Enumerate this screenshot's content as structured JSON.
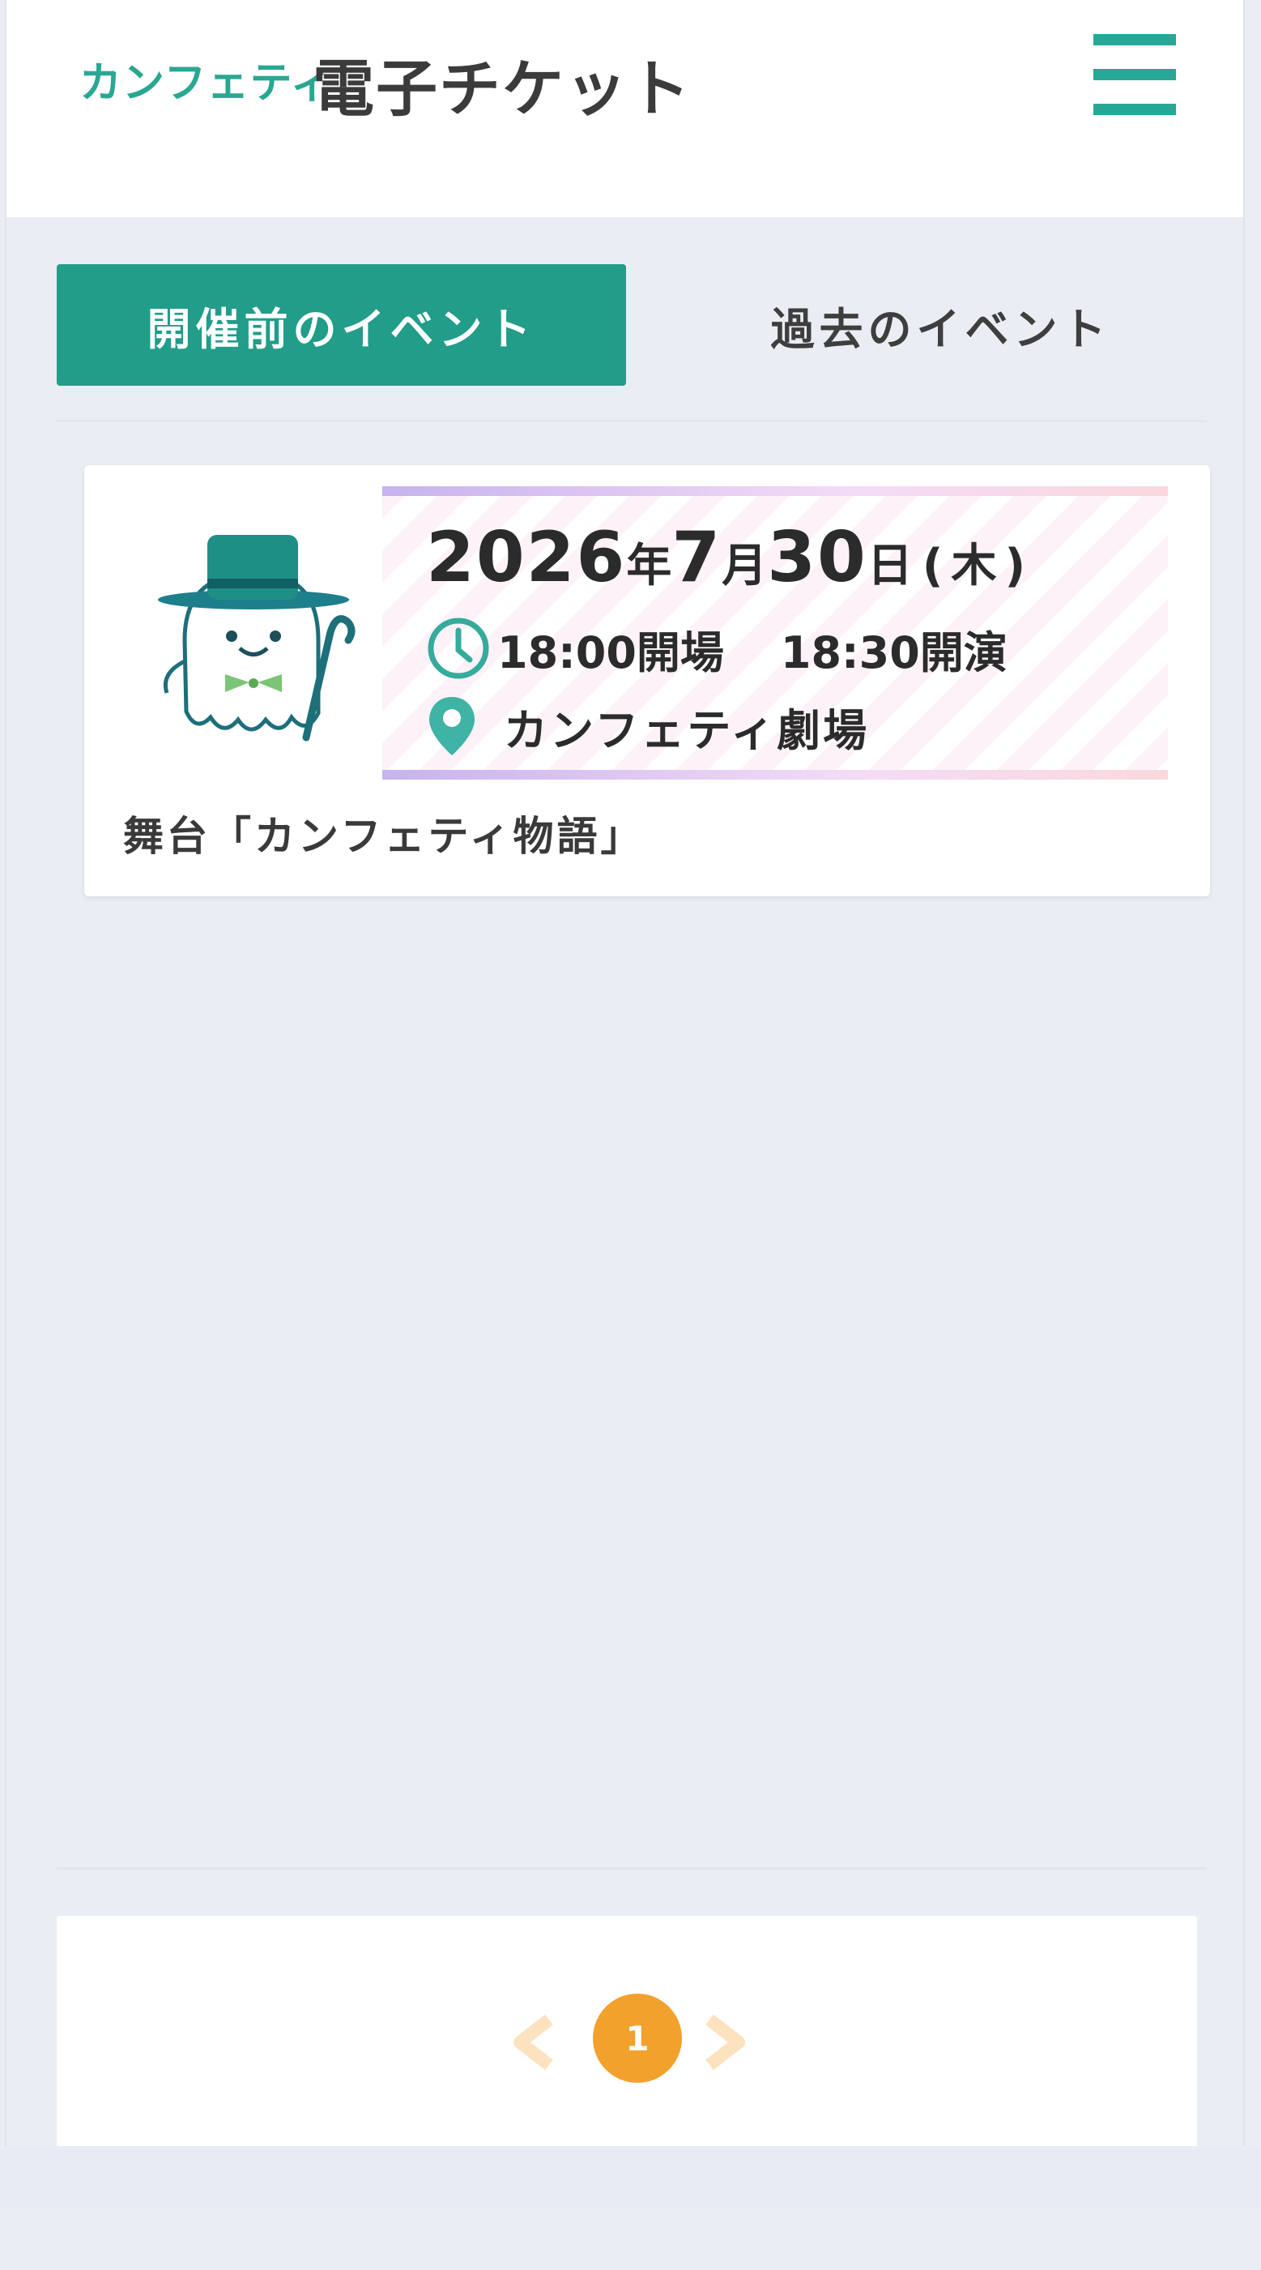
{
  "header": {
    "brand": "カンフェティ",
    "title": "電子チケット",
    "menu_icon": "hamburger-menu-icon"
  },
  "tabs": [
    {
      "label": "開催前のイベント",
      "active": true
    },
    {
      "label": "過去のイベント",
      "active": false
    }
  ],
  "events": [
    {
      "date_year": "2026",
      "date_year_unit": "年",
      "date_month": "7",
      "date_month_unit": "月",
      "date_day": "30",
      "date_day_unit": "日",
      "date_weekday": "(木)",
      "open_time": "18:00開場",
      "start_time": "18:30開演",
      "venue": "カンフェティ劇場",
      "title": "舞台「カンフェティ物語」",
      "mascot_icon": "ghost-mascot-icon",
      "time_icon": "clock-icon",
      "venue_icon": "map-pin-icon"
    }
  ],
  "pagination": {
    "current": "1",
    "prev_icon": "chevron-left-icon",
    "next_icon": "chevron-right-icon"
  },
  "colors": {
    "accent": "#219d8a",
    "page_background": "#eaedf3",
    "pager_active": "#f3a12d",
    "pager_arrow": "#fde2bf"
  }
}
